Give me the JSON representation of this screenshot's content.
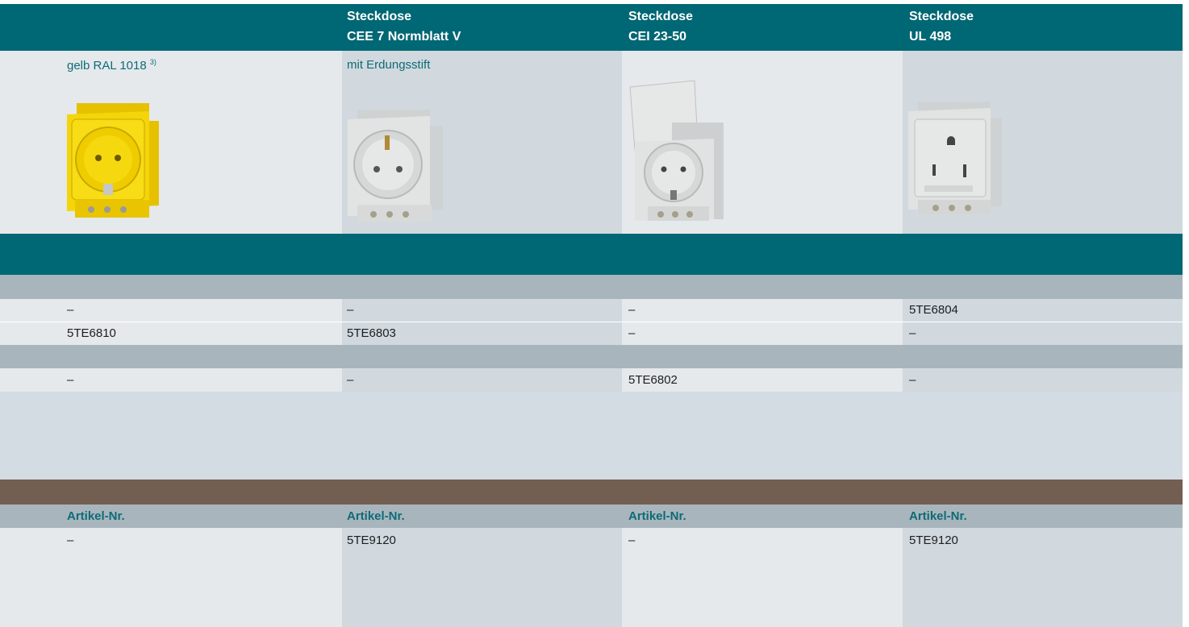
{
  "colors": {
    "header_teal": "#006774",
    "row_gray": "#a8b5bd",
    "light_gray": "#e5e9ec",
    "mid_gray": "#d4dce3",
    "brown_band": "#735e52",
    "accent_text": "#0e6b76"
  },
  "header": {
    "columns": [
      {
        "line1": "",
        "line2": ""
      },
      {
        "line1": "Steckdose",
        "line2": "CEE 7 Normblatt V"
      },
      {
        "line1": "Steckdose",
        "line2": "CEI 23-50"
      },
      {
        "line1": "Steckdose",
        "line2": "UL 498"
      }
    ]
  },
  "variants": [
    {
      "label": "gelb RAL 1018",
      "note": "3)",
      "image": "yellow-socket-icon"
    },
    {
      "label": "mit Erdungsstift",
      "note": "",
      "image": "gray-socket-pin-icon"
    },
    {
      "label": "",
      "note": "",
      "image": "socket-with-lid-icon"
    },
    {
      "label": "",
      "note": "",
      "image": "ul-socket-icon"
    }
  ],
  "table": {
    "rows": [
      [
        "–",
        "–",
        "–",
        "5TE6804"
      ],
      [
        "5TE6810",
        "5TE6803",
        "–",
        "–"
      ],
      [
        "–",
        "–",
        "5TE6802",
        "–"
      ]
    ]
  },
  "accessories": {
    "labels": [
      "Artikel-Nr.",
      "Artikel-Nr.",
      "Artikel-Nr.",
      "Artikel-Nr."
    ],
    "values": [
      "–",
      "5TE9120",
      "–",
      "5TE9120"
    ]
  }
}
